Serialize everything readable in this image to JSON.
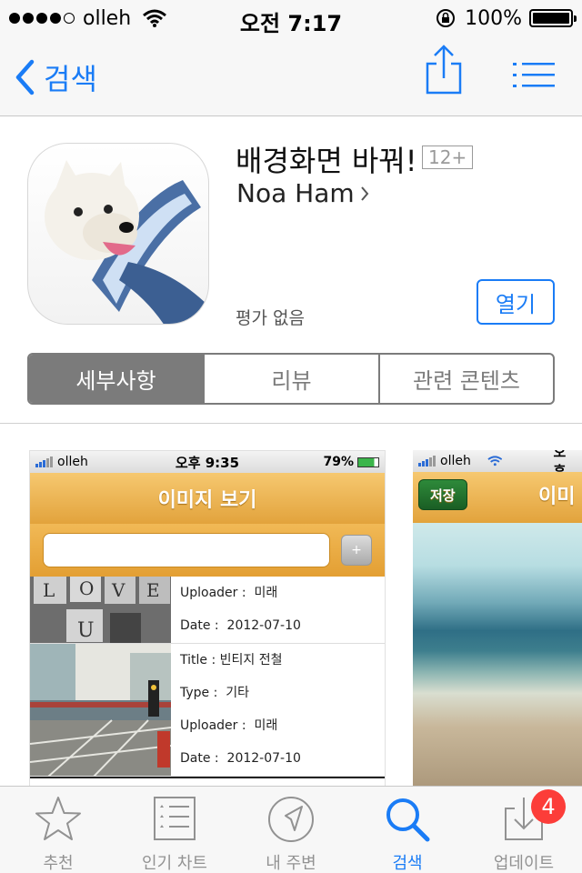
{
  "status_bar": {
    "carrier": "olleh",
    "time": "오전 7:17",
    "battery_percent": "100%",
    "battery_level": 1.0,
    "signal_bars_filled": 4,
    "signal_bars_total": 5
  },
  "nav": {
    "back_label": "검색",
    "icons": [
      "chevron-left-icon",
      "share-icon",
      "list-icon"
    ]
  },
  "app": {
    "name": "배경화면 바꿔!",
    "age_rating": "12+",
    "developer": "Noa Ham",
    "rating_text": "평가 없음",
    "open_button": "열기"
  },
  "segments": [
    {
      "label": "세부사항",
      "active": true
    },
    {
      "label": "리뷰",
      "active": false
    },
    {
      "label": "관련 콘텐츠",
      "active": false
    }
  ],
  "screenshots": {
    "shot1": {
      "carrier": "olleh",
      "time": "오후 9:35",
      "battery": "79%",
      "header_title": "이미지 보기",
      "add_button": "+",
      "rows": [
        {
          "uploader_label": "Uploader :",
          "uploader": "미래",
          "date_label": "Date :",
          "date": "2012-07-10"
        },
        {
          "title_label": "Title :",
          "title": "빈티지 전철",
          "type_label": "Type :",
          "type": "기타",
          "uploader_label": "Uploader :",
          "uploader": "미래",
          "date_label": "Date :",
          "date": "2012-07-10"
        }
      ]
    },
    "shot2": {
      "carrier": "olleh",
      "time": "오후",
      "save_button": "저장",
      "header_title": "이미"
    }
  },
  "tabbar": {
    "tabs": [
      {
        "label": "추천",
        "icon": "star-icon",
        "active": false
      },
      {
        "label": "인기 차트",
        "icon": "chart-list-icon",
        "active": false
      },
      {
        "label": "내 주변",
        "icon": "location-icon",
        "active": false
      },
      {
        "label": "검색",
        "icon": "search-icon",
        "active": true
      },
      {
        "label": "업데이트",
        "icon": "download-icon",
        "active": false
      }
    ],
    "updates_badge": "4"
  },
  "colors": {
    "accent": "#1a7cf6",
    "segment_gray": "#7b7b7b",
    "badge_red": "#fc3d39",
    "shot_header_orange": "#e2a33c"
  }
}
